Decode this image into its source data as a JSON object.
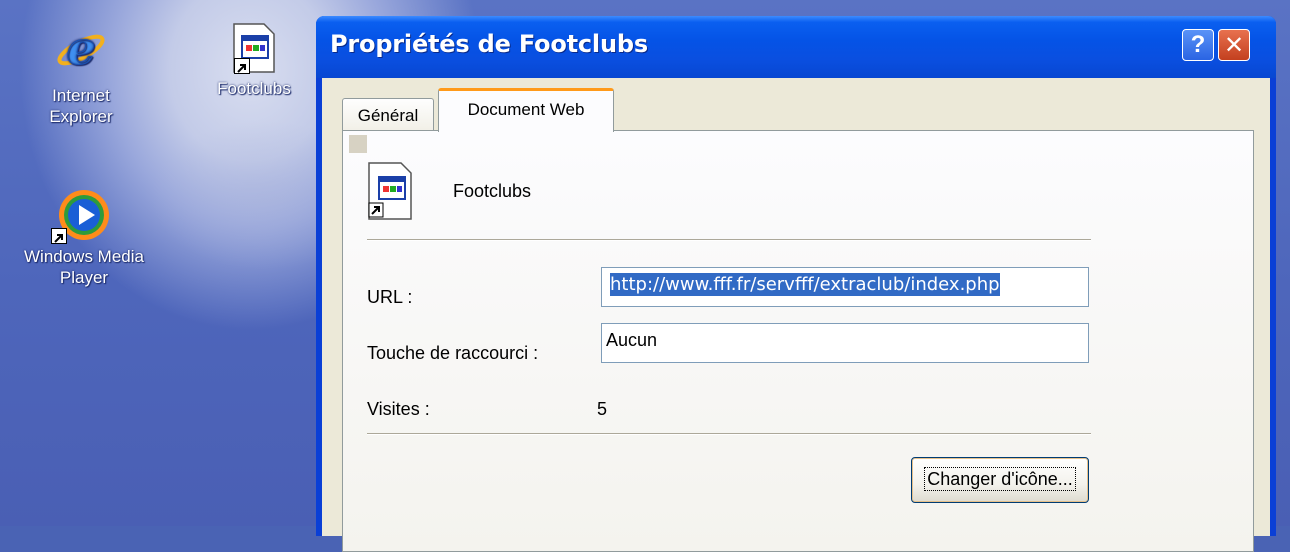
{
  "desktop": {
    "icons": [
      {
        "label_line1": "Internet",
        "label_line2": "Explorer",
        "icon": "internet-explorer-icon"
      },
      {
        "label_line1": "Windows Media",
        "label_line2": "Player",
        "icon": "windows-media-player-icon"
      },
      {
        "label_line1": "Footclubs",
        "icon": "web-shortcut-icon"
      }
    ]
  },
  "dialog": {
    "title": "Propriétés de Footclubs",
    "help_button": "?",
    "close_button": "✕",
    "tabs": [
      {
        "label": "Général",
        "active": false
      },
      {
        "label": "Document Web",
        "active": true
      }
    ],
    "file_name": "Footclubs",
    "url_label": "URL :",
    "url_value": "http://www.fff.fr/servfff/extraclub/index.php",
    "shortcut_label": "Touche de raccourci :",
    "shortcut_value": "Aucun",
    "visits_label": "Visites :",
    "visits_value": "5",
    "change_icon_button": "Changer d'icône..."
  },
  "colors": {
    "titlebar_blue": "#0553e6",
    "dialog_face": "#ece9d8",
    "selection": "#316ac5",
    "active_tab_accent": "#ff9a1a"
  }
}
